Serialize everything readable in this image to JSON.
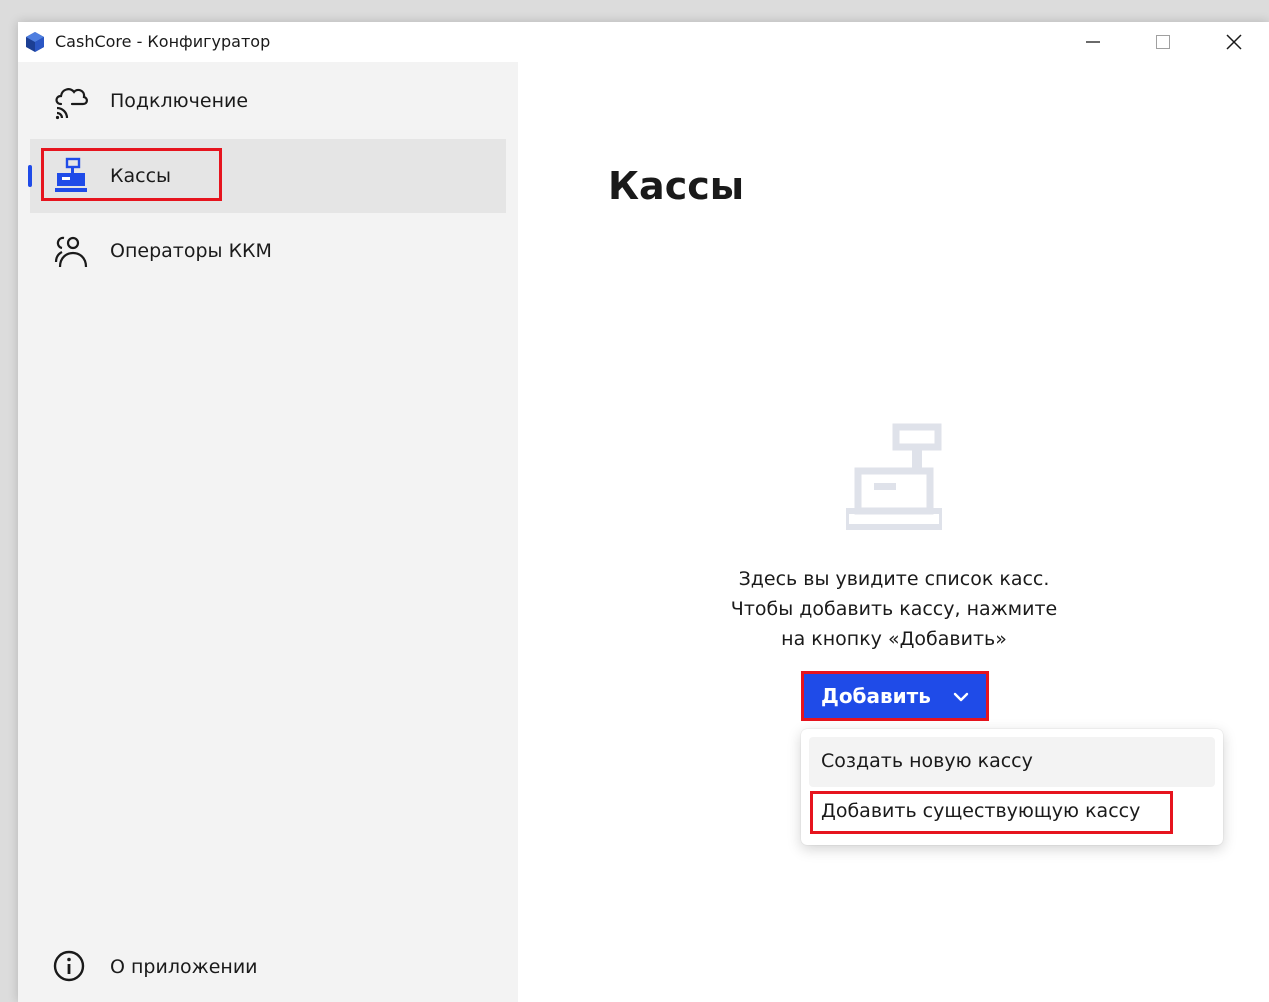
{
  "window": {
    "title": "CashCore - Конфигуратор",
    "app_icon": "cube-icon"
  },
  "sidebar": {
    "items": [
      {
        "label": "Подключение",
        "icon": "cloud-connection-icon",
        "selected": false
      },
      {
        "label": "Кассы",
        "icon": "cash-register-icon",
        "selected": true
      },
      {
        "label": "Операторы ККМ",
        "icon": "users-icon",
        "selected": false
      }
    ],
    "footer_item": {
      "label": "О приложении",
      "icon": "info-icon"
    }
  },
  "main": {
    "title": "Кассы",
    "empty_state": {
      "icon": "cash-register-icon",
      "lines": [
        "Здесь вы увидите список касс.",
        "Чтобы добавить кассу, нажмите",
        "на кнопку «Добавить»"
      ]
    },
    "add_button": {
      "label": "Добавить",
      "icon": "chevron-down-icon"
    },
    "dropdown": {
      "items": [
        {
          "label": "Создать новую кассу"
        },
        {
          "label": "Добавить существующую кассу"
        }
      ]
    }
  },
  "colors": {
    "accent": "#1f4be8",
    "highlight": "#e6141e",
    "sidebar_bg": "#f3f3f3",
    "empty_icon": "#dfe2ea"
  }
}
